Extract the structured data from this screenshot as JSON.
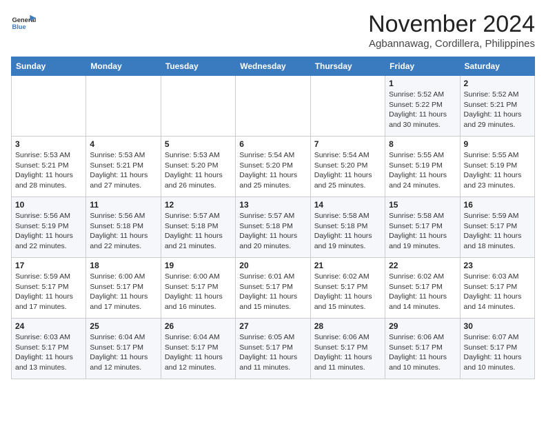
{
  "header": {
    "logo_line1": "General",
    "logo_line2": "Blue",
    "month": "November 2024",
    "location": "Agbannawag, Cordillera, Philippines"
  },
  "weekdays": [
    "Sunday",
    "Monday",
    "Tuesday",
    "Wednesday",
    "Thursday",
    "Friday",
    "Saturday"
  ],
  "weeks": [
    [
      {
        "day": "",
        "info": ""
      },
      {
        "day": "",
        "info": ""
      },
      {
        "day": "",
        "info": ""
      },
      {
        "day": "",
        "info": ""
      },
      {
        "day": "",
        "info": ""
      },
      {
        "day": "1",
        "info": "Sunrise: 5:52 AM\nSunset: 5:22 PM\nDaylight: 11 hours\nand 30 minutes."
      },
      {
        "day": "2",
        "info": "Sunrise: 5:52 AM\nSunset: 5:21 PM\nDaylight: 11 hours\nand 29 minutes."
      }
    ],
    [
      {
        "day": "3",
        "info": "Sunrise: 5:53 AM\nSunset: 5:21 PM\nDaylight: 11 hours\nand 28 minutes."
      },
      {
        "day": "4",
        "info": "Sunrise: 5:53 AM\nSunset: 5:21 PM\nDaylight: 11 hours\nand 27 minutes."
      },
      {
        "day": "5",
        "info": "Sunrise: 5:53 AM\nSunset: 5:20 PM\nDaylight: 11 hours\nand 26 minutes."
      },
      {
        "day": "6",
        "info": "Sunrise: 5:54 AM\nSunset: 5:20 PM\nDaylight: 11 hours\nand 25 minutes."
      },
      {
        "day": "7",
        "info": "Sunrise: 5:54 AM\nSunset: 5:20 PM\nDaylight: 11 hours\nand 25 minutes."
      },
      {
        "day": "8",
        "info": "Sunrise: 5:55 AM\nSunset: 5:19 PM\nDaylight: 11 hours\nand 24 minutes."
      },
      {
        "day": "9",
        "info": "Sunrise: 5:55 AM\nSunset: 5:19 PM\nDaylight: 11 hours\nand 23 minutes."
      }
    ],
    [
      {
        "day": "10",
        "info": "Sunrise: 5:56 AM\nSunset: 5:19 PM\nDaylight: 11 hours\nand 22 minutes."
      },
      {
        "day": "11",
        "info": "Sunrise: 5:56 AM\nSunset: 5:18 PM\nDaylight: 11 hours\nand 22 minutes."
      },
      {
        "day": "12",
        "info": "Sunrise: 5:57 AM\nSunset: 5:18 PM\nDaylight: 11 hours\nand 21 minutes."
      },
      {
        "day": "13",
        "info": "Sunrise: 5:57 AM\nSunset: 5:18 PM\nDaylight: 11 hours\nand 20 minutes."
      },
      {
        "day": "14",
        "info": "Sunrise: 5:58 AM\nSunset: 5:18 PM\nDaylight: 11 hours\nand 19 minutes."
      },
      {
        "day": "15",
        "info": "Sunrise: 5:58 AM\nSunset: 5:17 PM\nDaylight: 11 hours\nand 19 minutes."
      },
      {
        "day": "16",
        "info": "Sunrise: 5:59 AM\nSunset: 5:17 PM\nDaylight: 11 hours\nand 18 minutes."
      }
    ],
    [
      {
        "day": "17",
        "info": "Sunrise: 5:59 AM\nSunset: 5:17 PM\nDaylight: 11 hours\nand 17 minutes."
      },
      {
        "day": "18",
        "info": "Sunrise: 6:00 AM\nSunset: 5:17 PM\nDaylight: 11 hours\nand 17 minutes."
      },
      {
        "day": "19",
        "info": "Sunrise: 6:00 AM\nSunset: 5:17 PM\nDaylight: 11 hours\nand 16 minutes."
      },
      {
        "day": "20",
        "info": "Sunrise: 6:01 AM\nSunset: 5:17 PM\nDaylight: 11 hours\nand 15 minutes."
      },
      {
        "day": "21",
        "info": "Sunrise: 6:02 AM\nSunset: 5:17 PM\nDaylight: 11 hours\nand 15 minutes."
      },
      {
        "day": "22",
        "info": "Sunrise: 6:02 AM\nSunset: 5:17 PM\nDaylight: 11 hours\nand 14 minutes."
      },
      {
        "day": "23",
        "info": "Sunrise: 6:03 AM\nSunset: 5:17 PM\nDaylight: 11 hours\nand 14 minutes."
      }
    ],
    [
      {
        "day": "24",
        "info": "Sunrise: 6:03 AM\nSunset: 5:17 PM\nDaylight: 11 hours\nand 13 minutes."
      },
      {
        "day": "25",
        "info": "Sunrise: 6:04 AM\nSunset: 5:17 PM\nDaylight: 11 hours\nand 12 minutes."
      },
      {
        "day": "26",
        "info": "Sunrise: 6:04 AM\nSunset: 5:17 PM\nDaylight: 11 hours\nand 12 minutes."
      },
      {
        "day": "27",
        "info": "Sunrise: 6:05 AM\nSunset: 5:17 PM\nDaylight: 11 hours\nand 11 minutes."
      },
      {
        "day": "28",
        "info": "Sunrise: 6:06 AM\nSunset: 5:17 PM\nDaylight: 11 hours\nand 11 minutes."
      },
      {
        "day": "29",
        "info": "Sunrise: 6:06 AM\nSunset: 5:17 PM\nDaylight: 11 hours\nand 10 minutes."
      },
      {
        "day": "30",
        "info": "Sunrise: 6:07 AM\nSunset: 5:17 PM\nDaylight: 11 hours\nand 10 minutes."
      }
    ]
  ]
}
